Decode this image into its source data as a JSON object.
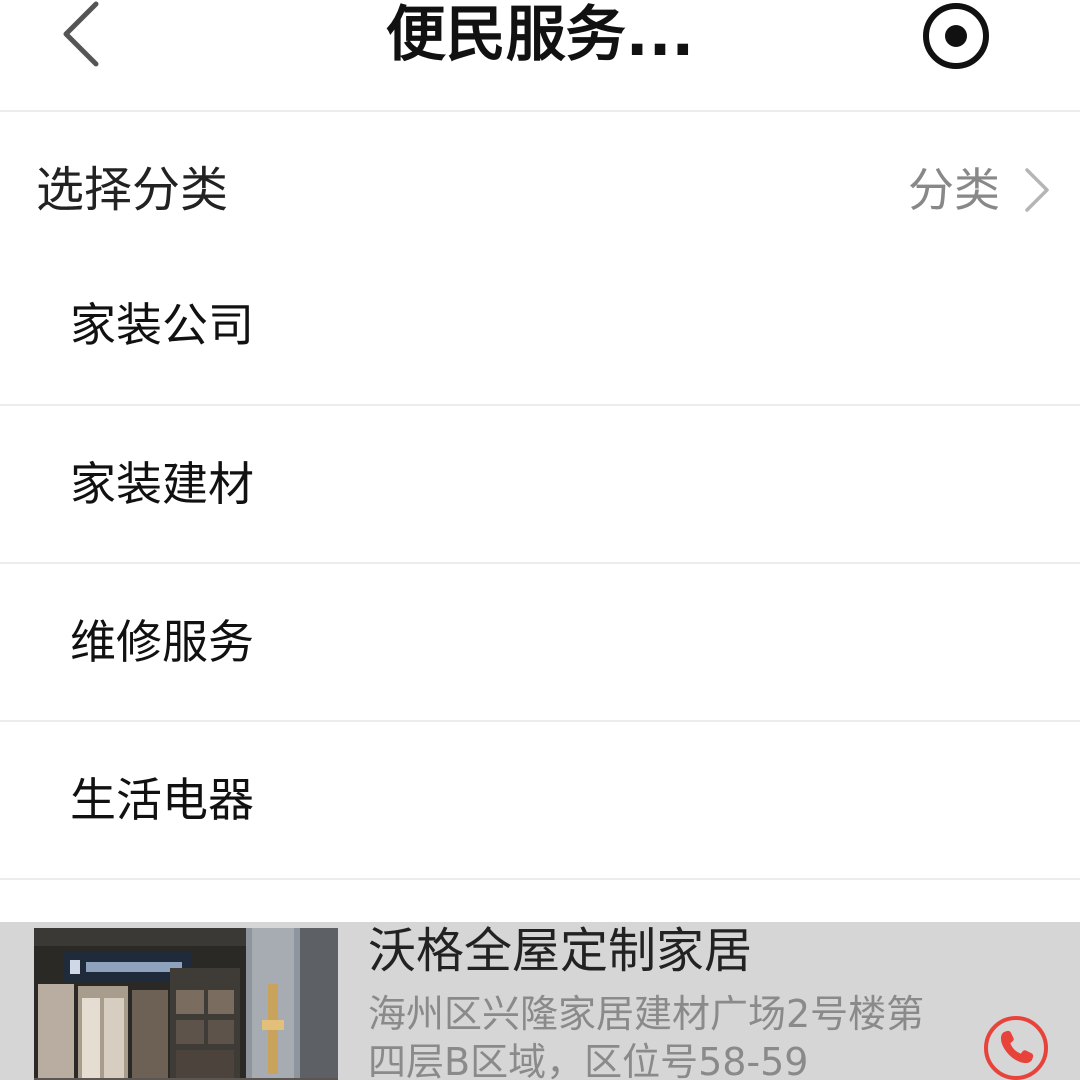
{
  "header": {
    "title": "便民服务...",
    "back_icon": "chevron-left-icon",
    "record_icon": "record-target-icon"
  },
  "category": {
    "title": "选择分类",
    "link_label": "分类",
    "link_icon": "chevron-right-icon"
  },
  "list": {
    "items": [
      {
        "label": "家装公司"
      },
      {
        "label": "家装建材"
      },
      {
        "label": "维修服务"
      },
      {
        "label": "生活电器"
      }
    ]
  },
  "shop": {
    "name": "沃格全屋定制家居",
    "address": "海州区兴隆家居建材广场2号楼第四层B区域，区位号58-59",
    "phone_icon": "phone-icon",
    "phone_color": "#e8433b"
  }
}
